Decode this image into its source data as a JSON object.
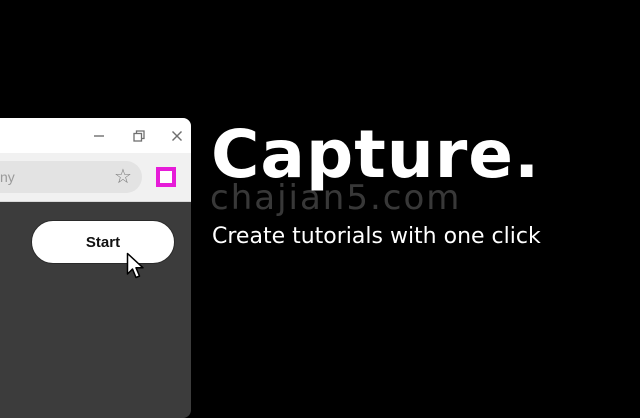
{
  "colors": {
    "background": "#000000",
    "browser_body": "#3c3c3c",
    "extension_accent": "#e61cd8"
  },
  "browser": {
    "window_controls": {
      "minimize_icon": "minimize-icon",
      "restore_icon": "restore-icon",
      "close_icon": "close-icon"
    },
    "toolbar": {
      "omnibox_text": "ny",
      "bookmark_icon": "star-icon",
      "extension_icon": "capture-extension-icon"
    },
    "content": {
      "start_label": "Start",
      "cursor_icon": "pointer-cursor-icon"
    }
  },
  "hero": {
    "headline": "Capture.",
    "subtitle": "Create tutorials with one click",
    "watermark": "chajian5.com"
  }
}
